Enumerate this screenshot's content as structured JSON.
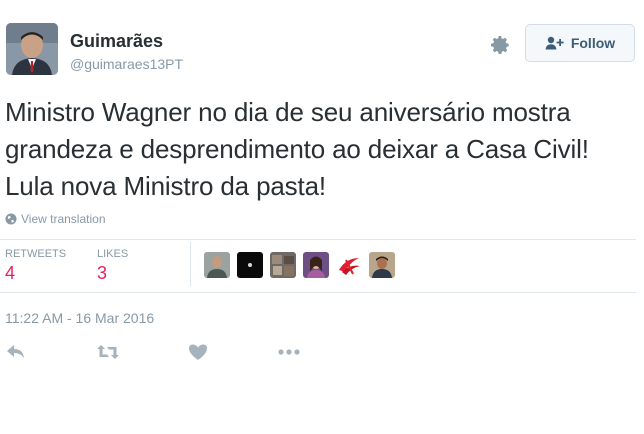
{
  "author": {
    "name": "Guimarães",
    "handle": "@guimaraes13PT"
  },
  "follow_button": {
    "label": "Follow"
  },
  "tweet": {
    "text": "Ministro Wagner no dia de seu aniversário mostra grandeza e desprendimento ao deixar a Casa Civil! Lula nova Ministro da pasta!",
    "translate_label": "View translation",
    "timestamp": "11:22 AM - 16 Mar 2016"
  },
  "stats": {
    "retweets_label": "RETWEETS",
    "retweets_value": "4",
    "likes_label": "LIKES",
    "likes_value": "3"
  },
  "icons": [
    "gear-icon",
    "follow-person-icon",
    "globe-icon",
    "reply-icon",
    "retweet-icon",
    "like-icon",
    "more-icon"
  ],
  "colors": {
    "accent": "#e0245e",
    "muted": "#8899a6",
    "text": "#292f33",
    "divider": "#e1e8ed",
    "follow_text": "#3b5c7a"
  }
}
